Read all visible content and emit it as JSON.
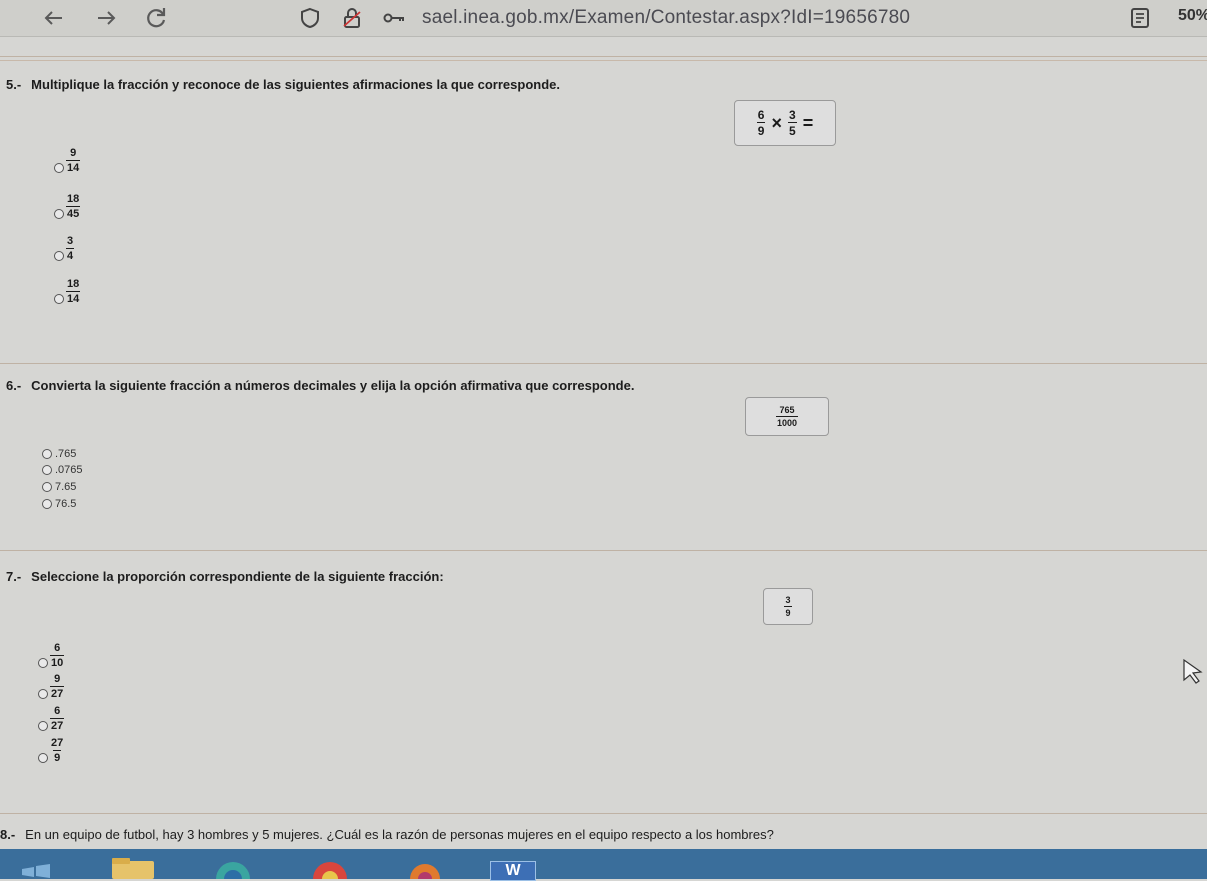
{
  "browser": {
    "url": "sael.inea.gob.mx/Examen/Contestar.aspx?IdI=19656780",
    "zoom": "50%",
    "icons": [
      "back-arrow-icon",
      "forward-arrow-icon",
      "reload-icon",
      "shield-icon",
      "lock-icon",
      "key-icon",
      "reader-view-icon"
    ]
  },
  "questions": [
    {
      "number": "5.-",
      "text": "Multiplique la fracción y reconoce de las siguientes afirmaciones la que corresponde.",
      "formula": {
        "a_num": "6",
        "a_den": "9",
        "op": "×",
        "b_num": "3",
        "b_den": "5",
        "eq": "="
      },
      "options": [
        {
          "num": "9",
          "den": "14"
        },
        {
          "num": "18",
          "den": "45"
        },
        {
          "num": "3",
          "den": "4"
        },
        {
          "num": "18",
          "den": "14"
        }
      ]
    },
    {
      "number": "6.-",
      "text": "Convierta la siguiente fracción a números decimales y elija la opción afirmativa que corresponde.",
      "formula": {
        "num": "765",
        "den": "1000"
      },
      "options": [
        ".765",
        ".0765",
        "7.65",
        "76.5"
      ]
    },
    {
      "number": "7.-",
      "text": "Seleccione la proporción correspondiente de la siguiente fracción:",
      "formula": {
        "num": "3",
        "den": "9"
      },
      "options": [
        {
          "num": "6",
          "den": "10"
        },
        {
          "num": "9",
          "den": "27"
        },
        {
          "num": "6",
          "den": "27"
        },
        {
          "num": "27",
          "den": "9"
        }
      ]
    },
    {
      "number": "8.-",
      "text": "En un equipo de futbol, hay 3 hombres y 5 mujeres. ¿Cuál es la razón de personas mujeres en el equipo respecto a los hombres?"
    }
  ],
  "taskbar": {
    "icons": [
      "start-icon",
      "file-explorer-icon",
      "edge-browser-icon",
      "chrome-icon",
      "firefox-icon",
      "word-icon"
    ],
    "word_label": "W"
  },
  "colors": {
    "toolbar": "#cfcfcb",
    "page": "#d6d6d3",
    "taskbar": "#3a6e9b",
    "divider": "#bfb2a4"
  }
}
